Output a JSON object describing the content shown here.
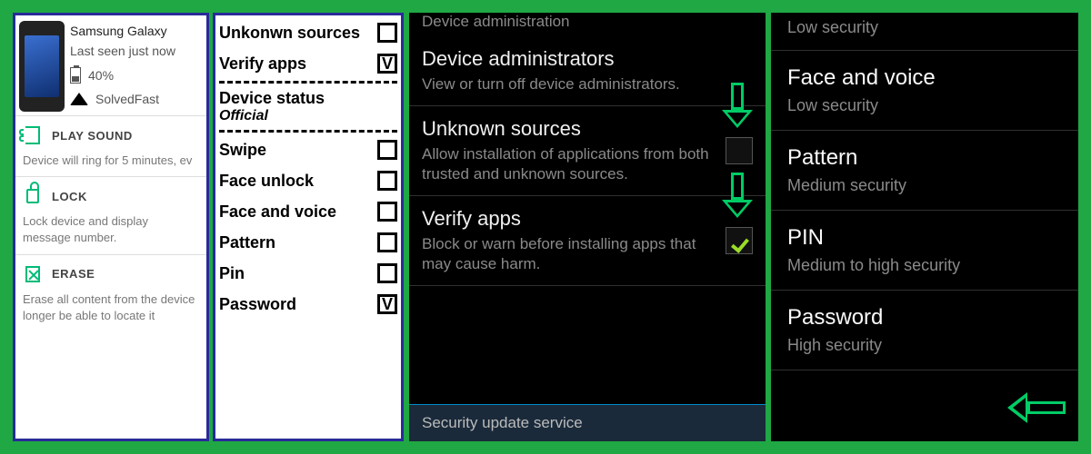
{
  "panel1": {
    "device_name": "Samsung Galaxy",
    "last_seen": "Last seen just now",
    "battery_pct": "40%",
    "wifi_name": "SolvedFast",
    "actions": {
      "play": {
        "title": "PLAY SOUND",
        "desc": "Device will ring for 5 minutes, ev"
      },
      "lock": {
        "title": "LOCK",
        "desc": "Lock device and display message number."
      },
      "erase": {
        "title": "ERASE",
        "desc": "Erase all content from the device longer be able to locate it"
      }
    }
  },
  "panel2": {
    "items_top": [
      {
        "label": "Unkonwn sources",
        "checked": false
      },
      {
        "label": "Verify apps",
        "checked": true
      }
    ],
    "status_label": "Device status",
    "status_value": "Official",
    "items_bottom": [
      {
        "label": "Swipe",
        "checked": false
      },
      {
        "label": "Face unlock",
        "checked": false
      },
      {
        "label": "Face and voice",
        "checked": false
      },
      {
        "label": "Pattern",
        "checked": false
      },
      {
        "label": "Pin",
        "checked": false
      },
      {
        "label": "Password",
        "checked": true
      }
    ]
  },
  "panel3": {
    "truncated_top": "Device administration",
    "items": [
      {
        "title": "Device administrators",
        "sub": "View or turn off device administrators.",
        "checkbox": null
      },
      {
        "title": "Unknown sources",
        "sub": "Allow installation of applications from both trusted and unknown sources.",
        "checkbox": false
      },
      {
        "title": "Verify apps",
        "sub": "Block or warn before installing apps that may cause harm.",
        "checkbox": true
      }
    ],
    "footer": "Security update service"
  },
  "panel4": {
    "items": [
      {
        "title": "",
        "sub": "Low security"
      },
      {
        "title": "Face and voice",
        "sub": "Low security"
      },
      {
        "title": "Pattern",
        "sub": "Medium security"
      },
      {
        "title": "PIN",
        "sub": "Medium to high security"
      },
      {
        "title": "Password",
        "sub": "High security"
      }
    ]
  }
}
